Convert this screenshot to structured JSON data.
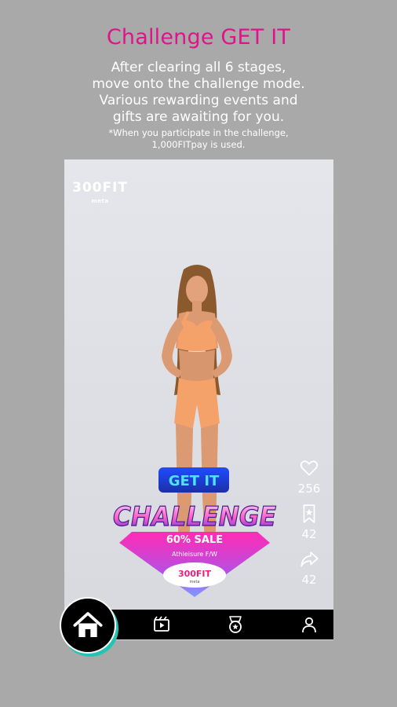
{
  "promo": {
    "title": "Challenge GET IT",
    "description_lines": [
      "After clearing all 6 stages,",
      "move onto the challenge mode.",
      "Various rewarding events and",
      "gifts are awaiting for you."
    ],
    "note_lines": [
      "*When you participate in the challenge,",
      "1,000FITpay is used."
    ]
  },
  "video": {
    "brand_logo": "300FIT",
    "brand_logo_sub": "meta",
    "challenge_badge": {
      "top_label": "GET IT",
      "main_label": "CHALLENGE",
      "sale_label": "60% SALE",
      "sub_label": "Athleisure F/W",
      "logo": "300FIT",
      "logo_sub": "meta"
    },
    "actions": {
      "like": {
        "icon": "heart-icon",
        "count": "256"
      },
      "bookmark": {
        "icon": "bookmark-star-icon",
        "count": "42"
      },
      "share": {
        "icon": "share-arrow-icon",
        "count": "42"
      }
    }
  },
  "bottom_nav": {
    "items": [
      {
        "name": "home",
        "icon": "home-icon"
      },
      {
        "name": "media",
        "icon": "media-play-icon"
      },
      {
        "name": "badge",
        "icon": "medal-icon"
      },
      {
        "name": "profile",
        "icon": "person-icon"
      }
    ]
  },
  "colors": {
    "background": "#a9a9a9",
    "title_accent": "#e0138c",
    "nav_background": "#000000",
    "home_ring_accent": "#23c4b5"
  }
}
